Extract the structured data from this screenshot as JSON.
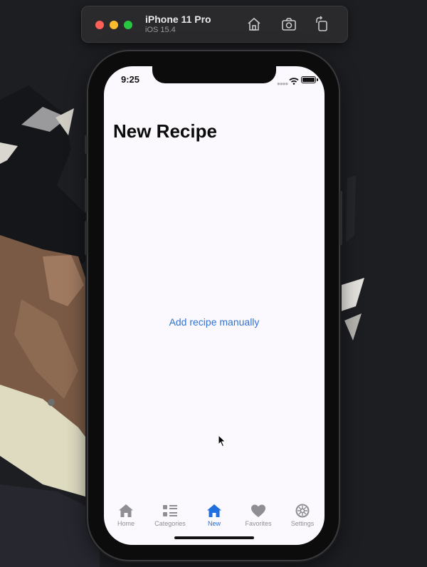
{
  "simulator": {
    "device_name": "iPhone 11 Pro",
    "os_version": "iOS 15.4"
  },
  "status_bar": {
    "time": "9:25"
  },
  "screen": {
    "title": "New Recipe",
    "add_manual_link": "Add recipe manually"
  },
  "tab_bar": {
    "items": [
      {
        "label": "Home",
        "icon": "house-icon",
        "active": false
      },
      {
        "label": "Categories",
        "icon": "list-icon",
        "active": false
      },
      {
        "label": "New",
        "icon": "house-icon",
        "active": true
      },
      {
        "label": "Favorites",
        "icon": "heart-icon",
        "active": false
      },
      {
        "label": "Settings",
        "icon": "gear-icon",
        "active": false
      }
    ]
  },
  "colors": {
    "accent": "#1f6fde",
    "inactive_tab": "#8e8e93",
    "screen_background": "#fbf9fd"
  }
}
